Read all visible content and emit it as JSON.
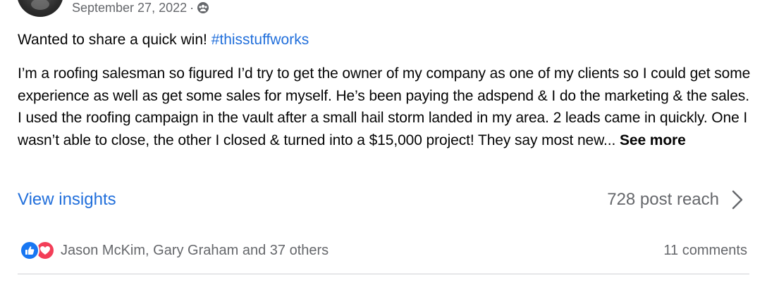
{
  "post": {
    "date": "September 27, 2022",
    "separator": "·",
    "audience_icon": "group-icon",
    "headline_text": "Wanted to share a quick win! ",
    "hashtag": "#thisstuffworks",
    "body_text": "I’m a roofing salesman so figured I’d try to get the owner of my company as one of my clients so I could get some experience as well as get some sales for myself. He’s been paying the adspend & I do the marketing & the sales. I used the roofing campaign in the vault after a small hail storm landed in my area. 2 leads came in quickly. One I wasn’t able to close, the other I closed & turned into a $15,000 project! They say most new... ",
    "see_more": "See more"
  },
  "insights": {
    "view_label": "View insights",
    "reach_text": "728 post reach"
  },
  "reactions": {
    "icons": [
      "like-icon",
      "love-icon"
    ],
    "names": "Jason McKim, Gary Graham and 37 others",
    "comments": "11 comments"
  },
  "colors": {
    "link_blue": "#216fdb",
    "secondary_text": "#65676b",
    "like_blue": "#1877f2",
    "love_red": "#f33e58"
  }
}
